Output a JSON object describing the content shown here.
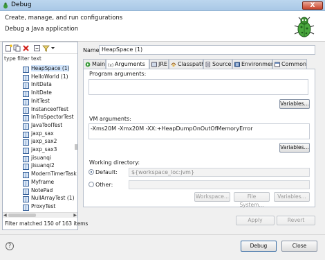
{
  "window": {
    "title": "Debug",
    "close_glyph": "X"
  },
  "header": {
    "title": "Create, manage, and run configurations",
    "subtitle": "Debug a Java application"
  },
  "left_panel": {
    "filter_placeholder": "type filter text",
    "items": [
      "HeapSpace (1)",
      "HelloWorld (1)",
      "InitData",
      "InitDate",
      "InitTest",
      "InstanceofTest",
      "InTroSpectorTest",
      "JavaToolTest",
      "jaxp_sax",
      "jaxp_sax2",
      "jaxp_sax3",
      "jisuanqi",
      "jisuanqi2",
      "ModernTimerTask",
      "Myframe",
      "NotePad",
      "NullArrayTest (1)",
      "ProxyTest"
    ],
    "selected_index": 0,
    "status": "Filter matched 150 of 163 items"
  },
  "name": {
    "label": "Name:",
    "value": "HeapSpace (1)"
  },
  "tabs": [
    "Main",
    "Arguments",
    "JRE",
    "Classpath",
    "Source",
    "Environment",
    "Common"
  ],
  "active_tab": 1,
  "arguments": {
    "program_label": "Program arguments:",
    "program_value": "",
    "vm_label": "VM arguments:",
    "vm_value": "-Xms20M -Xmx20M -XX:+HeapDumpOnOutOfMemoryError",
    "variables_label": "Variables...",
    "working_dir_label": "Working directory:",
    "default_label": "Default:",
    "default_value": "${workspace_loc:jvm}",
    "other_label": "Other:",
    "workspace_btn": "Workspace...",
    "filesystem_btn": "File System...",
    "variables_btn": "Variables..."
  },
  "footer": {
    "apply": "Apply",
    "revert": "Revert",
    "debug": "Debug",
    "close": "Close"
  },
  "colors": {
    "title_bar": "#a9c8e6",
    "selection": "#cfe3fb",
    "java_icon": "#2f5b96"
  }
}
